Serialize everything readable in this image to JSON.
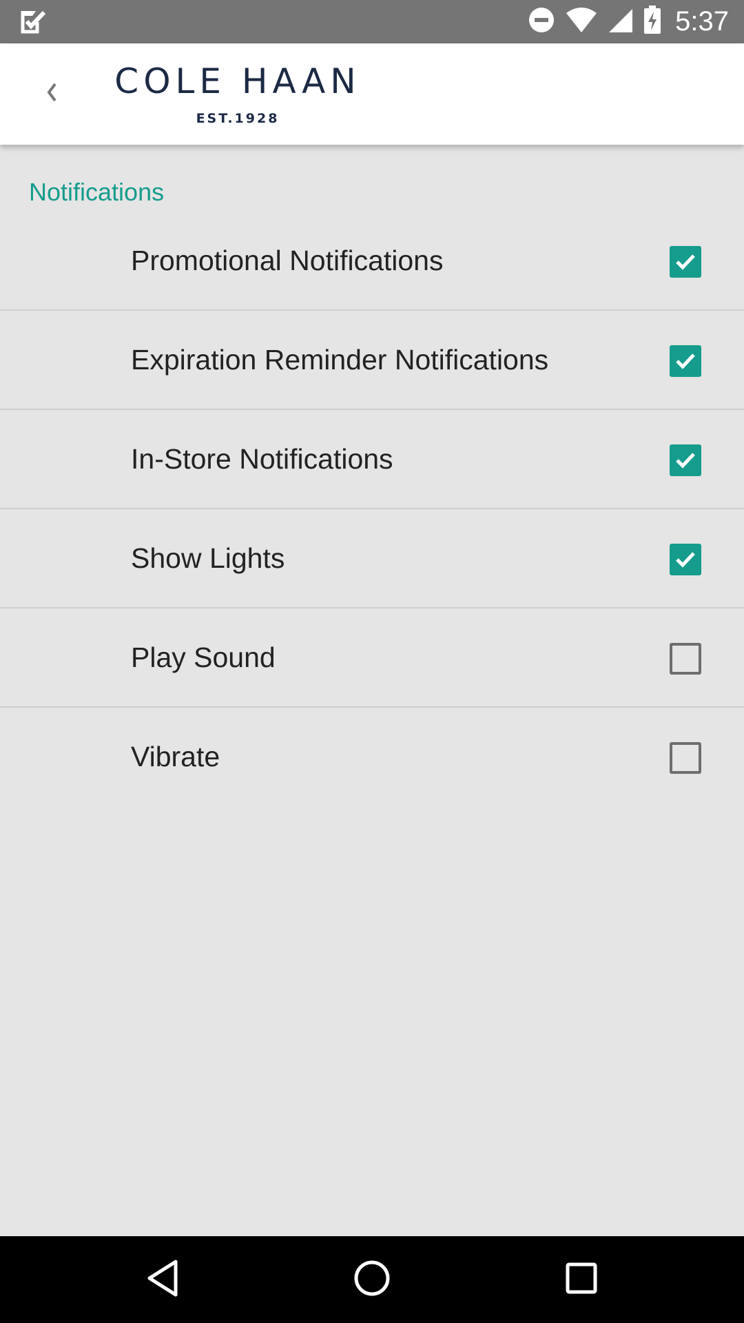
{
  "status_bar": {
    "time": "5:37",
    "icons": [
      "app-notification-icon",
      "do-not-disturb-icon",
      "wifi-icon",
      "cell-signal-icon",
      "battery-charging-icon"
    ]
  },
  "app_bar": {
    "back_icon": "back-chevron-icon",
    "logo": {
      "name": "COLE HAAN",
      "est": "EST.1928"
    }
  },
  "section": {
    "title": "Notifications"
  },
  "settings": [
    {
      "label": "Promotional Notifications",
      "checked": true
    },
    {
      "label": "Expiration Reminder Notifications",
      "checked": true
    },
    {
      "label": "In-Store Notifications",
      "checked": true
    },
    {
      "label": "Show Lights",
      "checked": true
    },
    {
      "label": "Play Sound",
      "checked": false
    },
    {
      "label": "Vibrate",
      "checked": false
    }
  ],
  "nav_bar": {
    "icons": [
      "back-triangle-icon",
      "home-circle-icon",
      "recents-square-icon"
    ]
  },
  "colors": {
    "accent": "#159c8c",
    "status_bar": "#757575",
    "background": "#e5e5e5",
    "logo_navy": "#1c2a44"
  }
}
